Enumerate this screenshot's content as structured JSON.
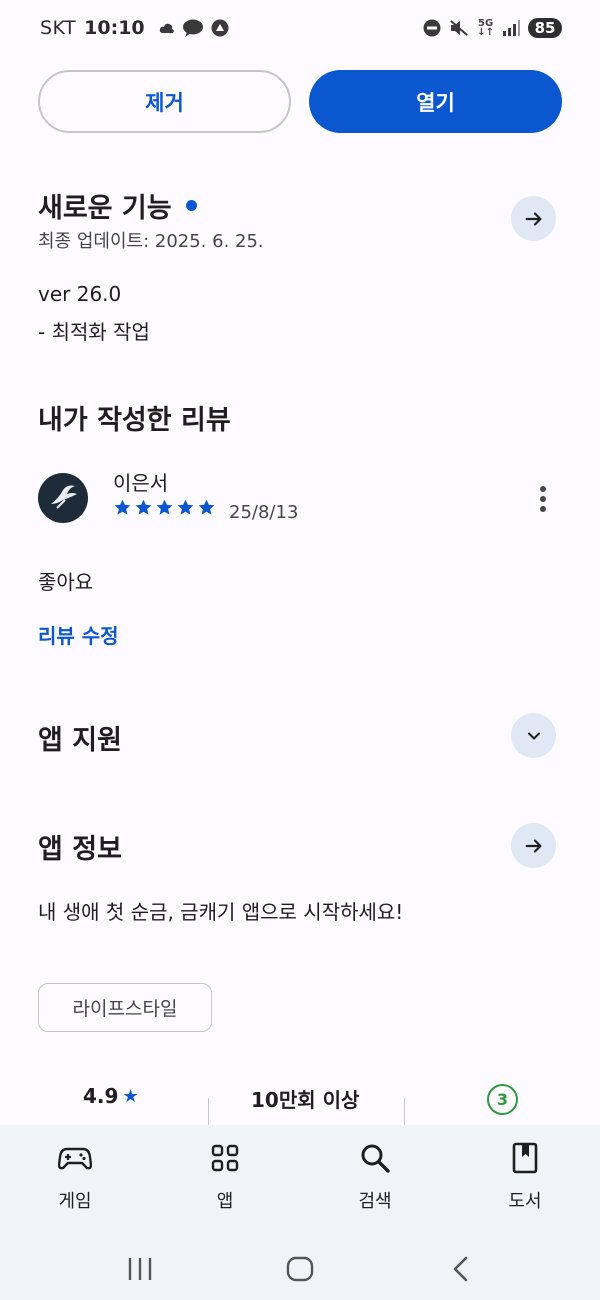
{
  "status_bar": {
    "carrier": "SKT",
    "time": "10:10",
    "network": "5G",
    "battery": "85"
  },
  "actions": {
    "remove_label": "제거",
    "open_label": "열기"
  },
  "whats_new": {
    "title": "새로운 기능",
    "last_updated": "최종 업데이트: 2025. 6. 25.",
    "version": "ver 26.0",
    "notes": "- 최적화 작업"
  },
  "my_review": {
    "title": "내가 작성한 리뷰",
    "reviewer": "이은서",
    "rating": 5,
    "date": "25/8/13",
    "text": "좋아요",
    "edit_label": "리뷰 수정"
  },
  "app_support": {
    "title": "앱 지원"
  },
  "app_info": {
    "title": "앱 정보",
    "description": "내 생애 첫 순금, 금캐기 앱으로 시작하세요!",
    "category": "라이프스타일"
  },
  "stats": {
    "rating": "4.9",
    "rating_star": "★",
    "downloads": "10만회 이상",
    "age_badge": "3"
  },
  "bottom_nav": {
    "items": [
      {
        "label": "게임",
        "icon": "gamepad-icon"
      },
      {
        "label": "앱",
        "icon": "apps-grid-icon"
      },
      {
        "label": "검색",
        "icon": "search-icon"
      },
      {
        "label": "도서",
        "icon": "book-icon"
      }
    ]
  },
  "colors": {
    "accent": "#0b57d0",
    "nav_background": "#f0f4f9",
    "age_badge": "#2e9a40"
  }
}
